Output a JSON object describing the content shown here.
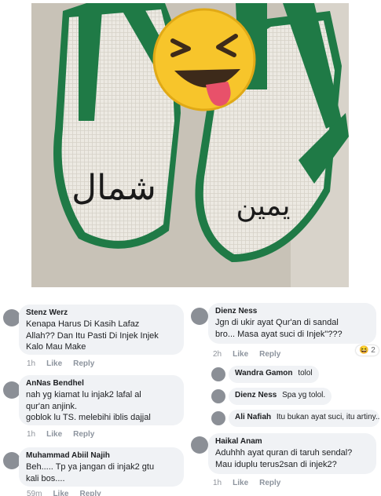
{
  "photo": {
    "left_label": "شمال",
    "right_label": "يمين",
    "emoji_name": "winking-tongue-face-emoji"
  },
  "left_panel": {
    "comments": [
      {
        "author": "Stenz Werz",
        "text": "Kenapa Harus Di Kasih Lafaz\nAllah?? Dan Itu Pasti Di Injek Injek\nKalo Mau Make",
        "time": "1h",
        "like": "Like",
        "reply": "Reply"
      },
      {
        "author": "AnNas Bendhel",
        "text": "nah yg kiamat lu injak2 lafal al\nqur'an anjink.\ngoblok lu TS. melebihi iblis dajjal",
        "time": "1h",
        "like": "Like",
        "reply": "Reply"
      },
      {
        "author": "Muhammad Abiil Najih",
        "text": "Beh..... Tp ya jangan di injak2 gtu\nkali bos....",
        "time": "59m",
        "like": "Like",
        "reply": "Reply"
      }
    ]
  },
  "right_panel": {
    "main_comment": {
      "author": "Dienz Ness",
      "text": "Jgn di ukir ayat Qur'an di sandal\nbro... Masa ayat suci di Injek\"???",
      "time": "2h",
      "like": "Like",
      "reply": "Reply",
      "reaction_emoji": "😆",
      "reaction_count": "2"
    },
    "replies": [
      {
        "author": "Wandra Gamon",
        "text": "tolol"
      },
      {
        "author": "Dienz Ness",
        "text": "Spa yg tolol."
      },
      {
        "author": "Ali Nafiah",
        "text": "Itu bukan ayat suci, itu artiny..."
      }
    ],
    "last_comment": {
      "author": "Haikal Anam",
      "text": "Aduhhh ayat quran di taruh sendal?\nMau iduplu terus2san di injek2?",
      "time": "1h",
      "like": "Like",
      "reply": "Reply"
    }
  },
  "colors": {
    "strap_green": "#1f7a46",
    "sole": "#e9e7e0",
    "bubble": "#f0f2f5",
    "meta": "#90949c"
  }
}
